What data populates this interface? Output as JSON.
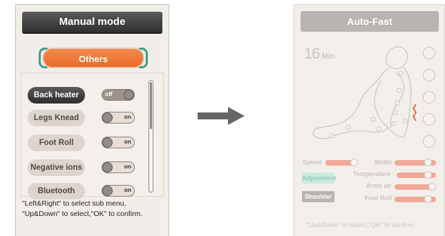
{
  "left_panel": {
    "title": "Manual mode",
    "category": "Others",
    "items": [
      {
        "label": "Back heater",
        "state": "off",
        "selected": true
      },
      {
        "label": "Legs Knead",
        "state": "on",
        "selected": false
      },
      {
        "label": "Foot Roll",
        "state": "on",
        "selected": false
      },
      {
        "label": "Negative ions",
        "state": "on",
        "selected": false
      },
      {
        "label": "Bluetooth",
        "state": "on",
        "selected": false
      }
    ],
    "hint_line1": "\"Left&Right\" to select sub menu,",
    "hint_line2": "\"Up&Down\" to select,\"OK\" to confirm."
  },
  "right_panel": {
    "title": "Auto-Fast",
    "time_value": "16",
    "time_unit": "Min",
    "sliders": {
      "speed": {
        "label": "Speed",
        "level": 0.9
      },
      "width": {
        "label": "Width",
        "level": 0.3
      },
      "temperature": {
        "label": "Temperature",
        "level": 0.3
      },
      "arms_air": {
        "label": "Arms air",
        "level": 0.0
      },
      "foot_roll": {
        "label": "Foot Roll",
        "level": 0.3
      }
    },
    "adjustment_label": "Adjustment",
    "shoulder_label": "Shoulder",
    "hint": "\"Up&Down\" to select,\"OK\" to confirm."
  },
  "colors": {
    "accent_orange": "#e86a28",
    "ring_green": "#3f9a86",
    "slider_salmon": "#f0a896",
    "adjust_green": "#c8ecdf"
  }
}
